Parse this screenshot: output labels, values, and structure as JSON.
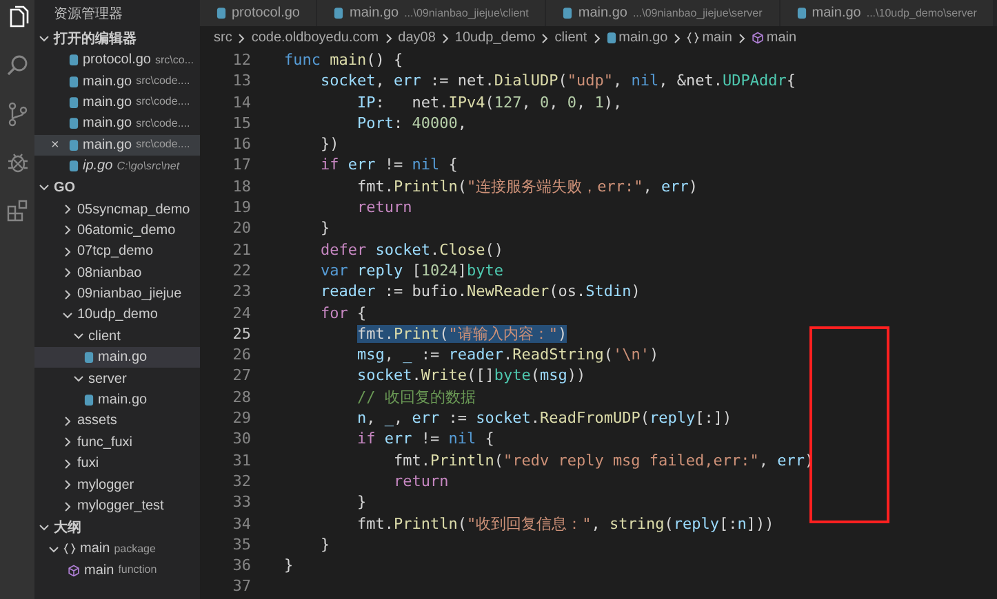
{
  "activity_bar": [
    {
      "kind": "files",
      "selected": true
    },
    {
      "kind": "search",
      "selected": false
    },
    {
      "kind": "source-control",
      "selected": false
    },
    {
      "kind": "debug",
      "selected": false
    },
    {
      "kind": "extensions",
      "selected": false
    }
  ],
  "sidebar": {
    "title": "资源管理器",
    "open_editors": {
      "title": "打开的编辑器",
      "expanded": true,
      "items": [
        {
          "name": "protocol.go",
          "path": "src\\co...",
          "preview": false,
          "hovered": false
        },
        {
          "name": "main.go",
          "path": "src\\code....",
          "preview": false,
          "hovered": false
        },
        {
          "name": "main.go",
          "path": "src\\code....",
          "preview": false,
          "hovered": false
        },
        {
          "name": "main.go",
          "path": "src\\code....",
          "preview": false,
          "hovered": false
        },
        {
          "name": "main.go",
          "path": "src\\code....",
          "preview": false,
          "hovered": true,
          "close": "×"
        },
        {
          "name": "ip.go",
          "path": "C:\\go\\src\\net",
          "preview": true,
          "hovered": false
        }
      ]
    },
    "folder": {
      "title": "GO",
      "expanded": true,
      "items": [
        {
          "name": "05syncmap_demo",
          "kind": "folder",
          "expanded": false,
          "selected": false
        },
        {
          "name": "06atomic_demo",
          "kind": "folder",
          "expanded": false,
          "selected": false
        },
        {
          "name": "07tcp_demo",
          "kind": "folder",
          "expanded": false,
          "selected": false
        },
        {
          "name": "08nianbao",
          "kind": "folder",
          "expanded": false,
          "selected": false
        },
        {
          "name": "09nianbao_jiejue",
          "kind": "folder",
          "expanded": false,
          "selected": false
        },
        {
          "name": "10udp_demo",
          "kind": "folder",
          "expanded": true,
          "selected": false,
          "children": [
            {
              "name": "client",
              "kind": "folder",
              "expanded": true,
              "selected": false,
              "children": [
                {
                  "name": "main.go",
                  "kind": "file",
                  "selected": true
                }
              ]
            },
            {
              "name": "server",
              "kind": "folder",
              "expanded": true,
              "selected": false,
              "children": [
                {
                  "name": "main.go",
                  "kind": "file",
                  "selected": false
                }
              ]
            }
          ]
        },
        {
          "name": "assets",
          "kind": "folder",
          "expanded": false,
          "selected": false
        },
        {
          "name": "func_fuxi",
          "kind": "folder",
          "expanded": false,
          "selected": false
        },
        {
          "name": "fuxi",
          "kind": "folder",
          "expanded": false,
          "selected": false
        },
        {
          "name": "mylogger",
          "kind": "folder",
          "expanded": false,
          "selected": false
        },
        {
          "name": "mylogger_test",
          "kind": "folder",
          "expanded": false,
          "selected": false
        }
      ]
    },
    "outline": {
      "title": "大纲",
      "expanded": true,
      "items": [
        {
          "name": "main",
          "detail": "package",
          "kind": "package",
          "expanded": true,
          "children": [
            {
              "name": "main",
              "detail": "function",
              "kind": "function"
            }
          ]
        }
      ]
    }
  },
  "tabs": [
    {
      "name": "protocol.go",
      "selected": false
    },
    {
      "name": "main.go",
      "detail": "...\\09nianbao_jiejue\\client",
      "selected": false
    },
    {
      "name": "main.go",
      "detail": "...\\09nianbao_jiejue\\server",
      "selected": false
    },
    {
      "name": "main.go",
      "detail": "...\\10udp_demo\\server",
      "selected": false
    }
  ],
  "breadcrumb": [
    {
      "text": "src",
      "kind": "folder"
    },
    {
      "text": "code.oldboyedu.com",
      "kind": "folder"
    },
    {
      "text": "day08",
      "kind": "folder"
    },
    {
      "text": "10udp_demo",
      "kind": "folder"
    },
    {
      "text": "client",
      "kind": "folder"
    },
    {
      "text": "main.go",
      "kind": "file"
    },
    {
      "text": "main",
      "kind": "package"
    },
    {
      "text": "main",
      "kind": "function"
    }
  ],
  "code": [
    {
      "n": "12",
      "current": false,
      "selected": false,
      "tokens": [
        {
          "text": "func ",
          "kind": "keyword"
        },
        {
          "text": "main",
          "kind": "function"
        },
        {
          "text": "() {",
          "kind": "plain"
        }
      ]
    },
    {
      "n": "13",
      "current": false,
      "selected": false,
      "tokens": [
        {
          "text": "    socket",
          "kind": "variable"
        },
        {
          "text": ", ",
          "kind": "plain"
        },
        {
          "text": "err",
          "kind": "variable"
        },
        {
          "text": " := net.",
          "kind": "plain"
        },
        {
          "text": "DialUDP",
          "kind": "function"
        },
        {
          "text": "(",
          "kind": "plain"
        },
        {
          "text": "\"udp\"",
          "kind": "string"
        },
        {
          "text": ", ",
          "kind": "plain"
        },
        {
          "text": "nil",
          "kind": "keyword"
        },
        {
          "text": ", &net.",
          "kind": "plain"
        },
        {
          "text": "UDPAddr",
          "kind": "type"
        },
        {
          "text": "{",
          "kind": "plain"
        }
      ]
    },
    {
      "n": "14",
      "current": false,
      "selected": false,
      "tokens": [
        {
          "text": "        IP",
          "kind": "variable"
        },
        {
          "text": ":   net.",
          "kind": "plain"
        },
        {
          "text": "IPv4",
          "kind": "function"
        },
        {
          "text": "(",
          "kind": "plain"
        },
        {
          "text": "127",
          "kind": "number"
        },
        {
          "text": ", ",
          "kind": "plain"
        },
        {
          "text": "0",
          "kind": "number"
        },
        {
          "text": ", ",
          "kind": "plain"
        },
        {
          "text": "0",
          "kind": "number"
        },
        {
          "text": ", ",
          "kind": "plain"
        },
        {
          "text": "1",
          "kind": "number"
        },
        {
          "text": "),",
          "kind": "plain"
        }
      ]
    },
    {
      "n": "15",
      "current": false,
      "selected": false,
      "tokens": [
        {
          "text": "        Port",
          "kind": "variable"
        },
        {
          "text": ": ",
          "kind": "plain"
        },
        {
          "text": "40000",
          "kind": "number"
        },
        {
          "text": ",",
          "kind": "plain"
        }
      ]
    },
    {
      "n": "16",
      "current": false,
      "selected": false,
      "tokens": [
        {
          "text": "    })",
          "kind": "plain"
        }
      ]
    },
    {
      "n": "17",
      "current": false,
      "selected": false,
      "tokens": [
        {
          "text": "    if ",
          "kind": "control"
        },
        {
          "text": "err",
          "kind": "variable"
        },
        {
          "text": " != ",
          "kind": "plain"
        },
        {
          "text": "nil",
          "kind": "keyword"
        },
        {
          "text": " {",
          "kind": "plain"
        }
      ]
    },
    {
      "n": "18",
      "current": false,
      "selected": false,
      "tokens": [
        {
          "text": "        fmt.",
          "kind": "plain"
        },
        {
          "text": "Println",
          "kind": "function"
        },
        {
          "text": "(",
          "kind": "plain"
        },
        {
          "text": "\"连接服务端失败，err:\"",
          "kind": "string"
        },
        {
          "text": ", ",
          "kind": "plain"
        },
        {
          "text": "err",
          "kind": "variable"
        },
        {
          "text": ")",
          "kind": "plain"
        }
      ]
    },
    {
      "n": "19",
      "current": false,
      "selected": false,
      "tokens": [
        {
          "text": "        return",
          "kind": "control"
        }
      ]
    },
    {
      "n": "20",
      "current": false,
      "selected": false,
      "tokens": [
        {
          "text": "    }",
          "kind": "plain"
        }
      ]
    },
    {
      "n": "21",
      "current": false,
      "selected": false,
      "tokens": [
        {
          "text": "    defer ",
          "kind": "control"
        },
        {
          "text": "socket",
          "kind": "variable"
        },
        {
          "text": ".",
          "kind": "plain"
        },
        {
          "text": "Close",
          "kind": "function"
        },
        {
          "text": "()",
          "kind": "plain"
        }
      ]
    },
    {
      "n": "22",
      "current": false,
      "selected": false,
      "tokens": [
        {
          "text": "    var ",
          "kind": "keyword"
        },
        {
          "text": "reply",
          "kind": "variable"
        },
        {
          "text": " [",
          "kind": "plain"
        },
        {
          "text": "1024",
          "kind": "number"
        },
        {
          "text": "]",
          "kind": "plain"
        },
        {
          "text": "byte",
          "kind": "type"
        }
      ]
    },
    {
      "n": "23",
      "current": false,
      "selected": false,
      "tokens": [
        {
          "text": "    reader",
          "kind": "variable"
        },
        {
          "text": " := bufio.",
          "kind": "plain"
        },
        {
          "text": "NewReader",
          "kind": "function"
        },
        {
          "text": "(os.",
          "kind": "plain"
        },
        {
          "text": "Stdin",
          "kind": "variable"
        },
        {
          "text": ")",
          "kind": "plain"
        }
      ]
    },
    {
      "n": "24",
      "current": false,
      "selected": false,
      "tokens": [
        {
          "text": "    for",
          "kind": "control"
        },
        {
          "text": " {",
          "kind": "plain"
        }
      ]
    },
    {
      "n": "25",
      "current": true,
      "selected": true,
      "tokens": [
        {
          "text": "        fmt.",
          "kind": "plain"
        },
        {
          "text": "Print",
          "kind": "function"
        },
        {
          "text": "(",
          "kind": "plain"
        },
        {
          "text": "\"请输入内容：\"",
          "kind": "string"
        },
        {
          "text": ")",
          "kind": "plain"
        }
      ]
    },
    {
      "n": "26",
      "current": false,
      "selected": false,
      "tokens": [
        {
          "text": "        msg",
          "kind": "variable"
        },
        {
          "text": ", ",
          "kind": "plain"
        },
        {
          "text": "_",
          "kind": "variable"
        },
        {
          "text": " := ",
          "kind": "plain"
        },
        {
          "text": "reader",
          "kind": "variable"
        },
        {
          "text": ".",
          "kind": "plain"
        },
        {
          "text": "ReadString",
          "kind": "function"
        },
        {
          "text": "(",
          "kind": "plain"
        },
        {
          "text": "'\\n'",
          "kind": "string"
        },
        {
          "text": ")",
          "kind": "plain"
        }
      ]
    },
    {
      "n": "27",
      "current": false,
      "selected": false,
      "tokens": [
        {
          "text": "        socket",
          "kind": "variable"
        },
        {
          "text": ".",
          "kind": "plain"
        },
        {
          "text": "Write",
          "kind": "function"
        },
        {
          "text": "([]",
          "kind": "plain"
        },
        {
          "text": "byte",
          "kind": "type"
        },
        {
          "text": "(",
          "kind": "plain"
        },
        {
          "text": "msg",
          "kind": "variable"
        },
        {
          "text": "))",
          "kind": "plain"
        }
      ]
    },
    {
      "n": "28",
      "current": false,
      "selected": false,
      "tokens": [
        {
          "text": "        // 收回复的数据",
          "kind": "comment"
        }
      ]
    },
    {
      "n": "29",
      "current": false,
      "selected": false,
      "tokens": [
        {
          "text": "        n",
          "kind": "variable"
        },
        {
          "text": ", ",
          "kind": "plain"
        },
        {
          "text": "_",
          "kind": "variable"
        },
        {
          "text": ", ",
          "kind": "plain"
        },
        {
          "text": "err",
          "kind": "variable"
        },
        {
          "text": " := ",
          "kind": "plain"
        },
        {
          "text": "socket",
          "kind": "variable"
        },
        {
          "text": ".",
          "kind": "plain"
        },
        {
          "text": "ReadFromUDP",
          "kind": "function"
        },
        {
          "text": "(",
          "kind": "plain"
        },
        {
          "text": "reply",
          "kind": "variable"
        },
        {
          "text": "[:])",
          "kind": "plain"
        }
      ]
    },
    {
      "n": "30",
      "current": false,
      "selected": false,
      "tokens": [
        {
          "text": "        if ",
          "kind": "control"
        },
        {
          "text": "err",
          "kind": "variable"
        },
        {
          "text": " != ",
          "kind": "plain"
        },
        {
          "text": "nil",
          "kind": "keyword"
        },
        {
          "text": " {",
          "kind": "plain"
        }
      ]
    },
    {
      "n": "31",
      "current": false,
      "selected": false,
      "tokens": [
        {
          "text": "            fmt.",
          "kind": "plain"
        },
        {
          "text": "Println",
          "kind": "function"
        },
        {
          "text": "(",
          "kind": "plain"
        },
        {
          "text": "\"redv reply msg failed,err:\"",
          "kind": "string"
        },
        {
          "text": ", ",
          "kind": "plain"
        },
        {
          "text": "err",
          "kind": "variable"
        },
        {
          "text": ")",
          "kind": "plain"
        }
      ]
    },
    {
      "n": "32",
      "current": false,
      "selected": false,
      "tokens": [
        {
          "text": "            return",
          "kind": "control"
        }
      ]
    },
    {
      "n": "33",
      "current": false,
      "selected": false,
      "tokens": [
        {
          "text": "        }",
          "kind": "plain"
        }
      ]
    },
    {
      "n": "34",
      "current": false,
      "selected": false,
      "tokens": [
        {
          "text": "        fmt.",
          "kind": "plain"
        },
        {
          "text": "Println",
          "kind": "function"
        },
        {
          "text": "(",
          "kind": "plain"
        },
        {
          "text": "\"收到回复信息：\"",
          "kind": "string"
        },
        {
          "text": ", ",
          "kind": "plain"
        },
        {
          "text": "string",
          "kind": "function"
        },
        {
          "text": "(",
          "kind": "plain"
        },
        {
          "text": "reply",
          "kind": "variable"
        },
        {
          "text": "[:",
          "kind": "plain"
        },
        {
          "text": "n",
          "kind": "variable"
        },
        {
          "text": "]))",
          "kind": "plain"
        }
      ]
    },
    {
      "n": "35",
      "current": false,
      "selected": false,
      "tokens": [
        {
          "text": "    }",
          "kind": "plain"
        }
      ]
    },
    {
      "n": "36",
      "current": false,
      "selected": false,
      "tokens": [
        {
          "text": "}",
          "kind": "plain"
        }
      ]
    },
    {
      "n": "37",
      "current": false
    }
  ],
  "annotation": {
    "kind": "rectangle",
    "color": "#ff2020"
  }
}
